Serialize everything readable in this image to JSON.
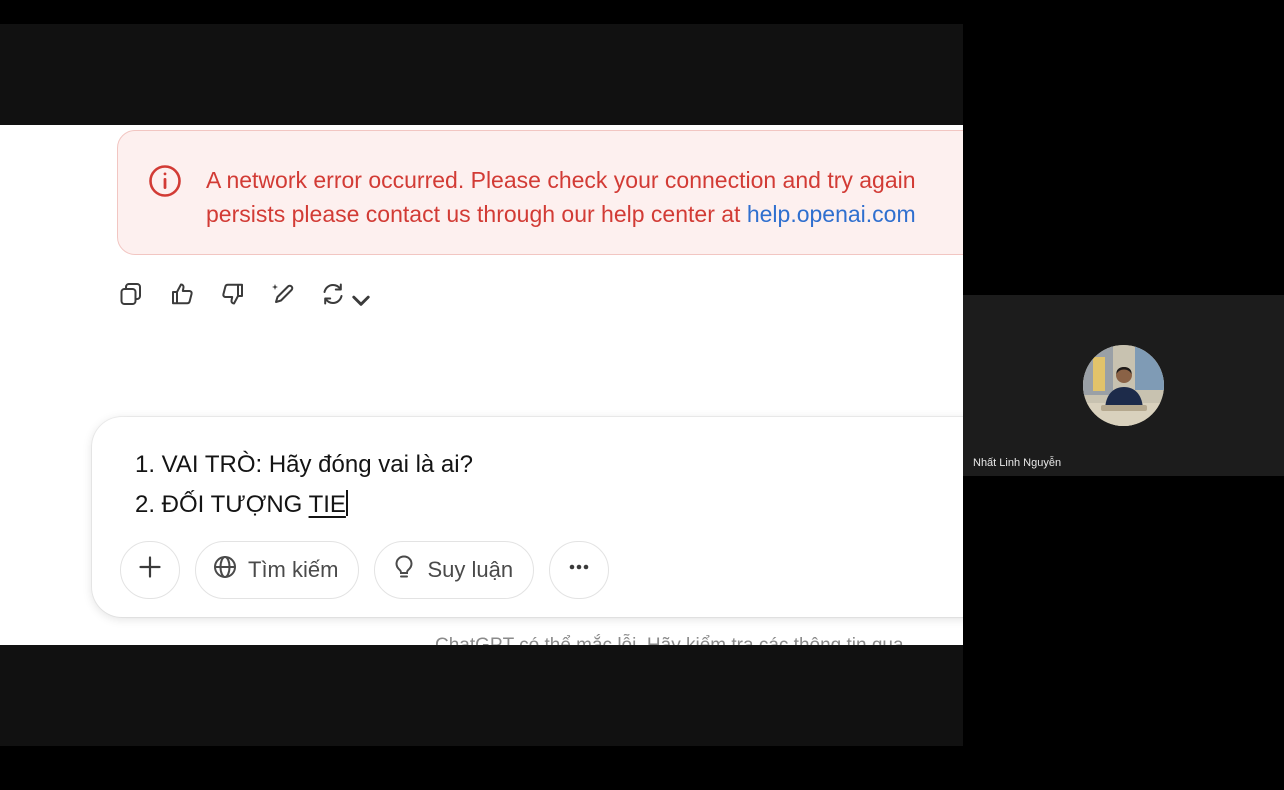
{
  "error_banner": {
    "line1": "A network error occurred. Please check your connection and try again",
    "line2_prefix": "persists please contact us through our help center at ",
    "link_text": "help.openai.com",
    "text_color": "#d23b35",
    "background": "#fdf0ef"
  },
  "message_actions": {
    "items": [
      "copy-icon",
      "thumbs-up-icon",
      "thumbs-down-icon",
      "edit-in-canvas-icon",
      "regenerate-icon"
    ]
  },
  "composer": {
    "line1": "1. VAI TRÒ: Hãy đóng vai là ai?",
    "line2_prefix": "2. ĐỐI TƯỢNG ",
    "line2_underlined": "TIE",
    "search_label": "Tìm kiếm",
    "reason_label": "Suy luận"
  },
  "disclaimer": "ChatGPT có thể mắc lỗi. Hãy kiểm tra các thông tin qua",
  "participant": {
    "name": "Nhất Linh Nguyễn"
  }
}
